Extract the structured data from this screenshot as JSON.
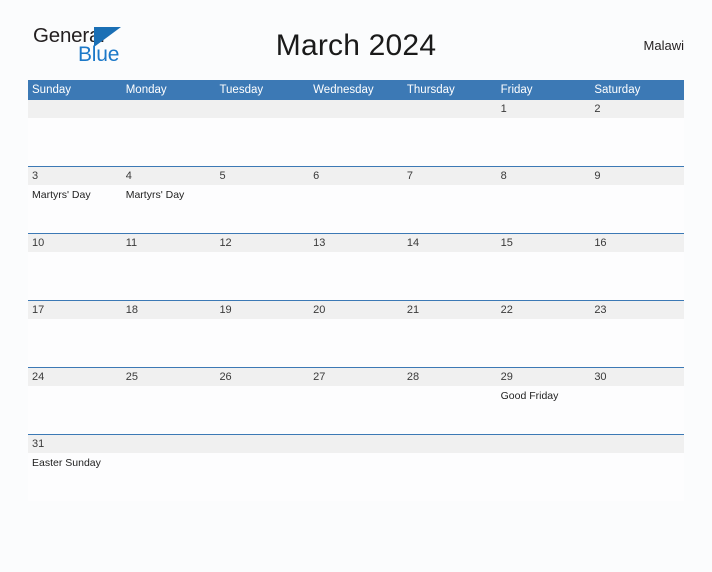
{
  "brand": {
    "name_part1": "General",
    "name_part2": "Blue",
    "flag_icon": "blue-triangle-flag-icon",
    "color_dark": "#231f20",
    "color_blue": "#1b78c8"
  },
  "header": {
    "title": "March 2024",
    "country": "Malawi"
  },
  "colors": {
    "header_blue": "#3c79b5",
    "date_band_gray": "#f0f0f0",
    "page_background": "#fbfcfd"
  },
  "calendar": {
    "weekdays": [
      "Sunday",
      "Monday",
      "Tuesday",
      "Wednesday",
      "Thursday",
      "Friday",
      "Saturday"
    ],
    "weeks": [
      {
        "days": [
          {
            "date": "",
            "events": []
          },
          {
            "date": "",
            "events": []
          },
          {
            "date": "",
            "events": []
          },
          {
            "date": "",
            "events": []
          },
          {
            "date": "",
            "events": []
          },
          {
            "date": "1",
            "events": []
          },
          {
            "date": "2",
            "events": []
          }
        ]
      },
      {
        "days": [
          {
            "date": "3",
            "events": [
              "Martyrs' Day"
            ]
          },
          {
            "date": "4",
            "events": [
              "Martyrs' Day"
            ]
          },
          {
            "date": "5",
            "events": []
          },
          {
            "date": "6",
            "events": []
          },
          {
            "date": "7",
            "events": []
          },
          {
            "date": "8",
            "events": []
          },
          {
            "date": "9",
            "events": []
          }
        ]
      },
      {
        "days": [
          {
            "date": "10",
            "events": []
          },
          {
            "date": "11",
            "events": []
          },
          {
            "date": "12",
            "events": []
          },
          {
            "date": "13",
            "events": []
          },
          {
            "date": "14",
            "events": []
          },
          {
            "date": "15",
            "events": []
          },
          {
            "date": "16",
            "events": []
          }
        ]
      },
      {
        "days": [
          {
            "date": "17",
            "events": []
          },
          {
            "date": "18",
            "events": []
          },
          {
            "date": "19",
            "events": []
          },
          {
            "date": "20",
            "events": []
          },
          {
            "date": "21",
            "events": []
          },
          {
            "date": "22",
            "events": []
          },
          {
            "date": "23",
            "events": []
          }
        ]
      },
      {
        "days": [
          {
            "date": "24",
            "events": []
          },
          {
            "date": "25",
            "events": []
          },
          {
            "date": "26",
            "events": []
          },
          {
            "date": "27",
            "events": []
          },
          {
            "date": "28",
            "events": []
          },
          {
            "date": "29",
            "events": [
              "Good Friday"
            ]
          },
          {
            "date": "30",
            "events": []
          }
        ]
      },
      {
        "days": [
          {
            "date": "31",
            "events": [
              "Easter Sunday"
            ]
          },
          {
            "date": "",
            "events": []
          },
          {
            "date": "",
            "events": []
          },
          {
            "date": "",
            "events": []
          },
          {
            "date": "",
            "events": []
          },
          {
            "date": "",
            "events": []
          },
          {
            "date": "",
            "events": []
          }
        ]
      }
    ]
  }
}
